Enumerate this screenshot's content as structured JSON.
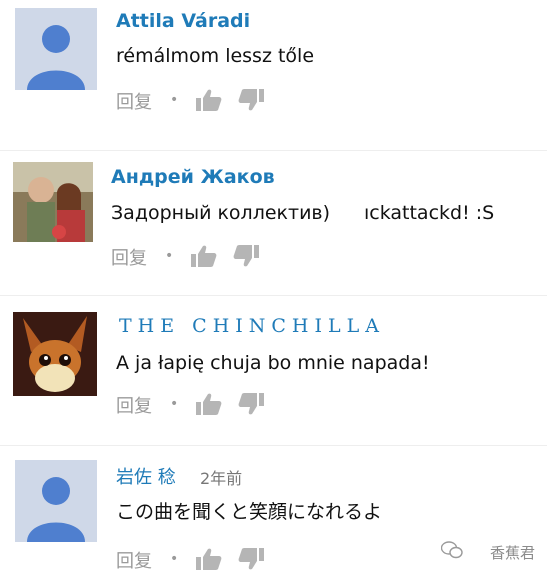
{
  "comments": [
    {
      "author": "Attila Váradi",
      "text": "rémálmom lessz tőle",
      "avatar": "default-avatar",
      "reply_label": "回复"
    },
    {
      "author": "Андрей Жаков",
      "text": "Задорный коллектив)",
      "overlay_text": "ıckattackd! :S",
      "avatar": "photo-avatar",
      "reply_label": "回复"
    },
    {
      "author": "THE CHINCHILLA",
      "text": "A ja łapię chuja bo mnie napada!",
      "avatar": "cartoon-fox-avatar",
      "reply_label": "回复"
    },
    {
      "author": "岩佐 稔",
      "age": "2年前",
      "text": "この曲を聞くと笑顔になれるよ",
      "avatar": "default-avatar",
      "reply_label": "回复"
    }
  ],
  "dot": "•",
  "watermark": "香蕉君",
  "colors": {
    "author_link": "#1f7bb8",
    "default_avatar_bg": "#cfd8e8",
    "default_avatar_figure": "#4f7fcf",
    "action_icon": "#b5b5b5"
  }
}
